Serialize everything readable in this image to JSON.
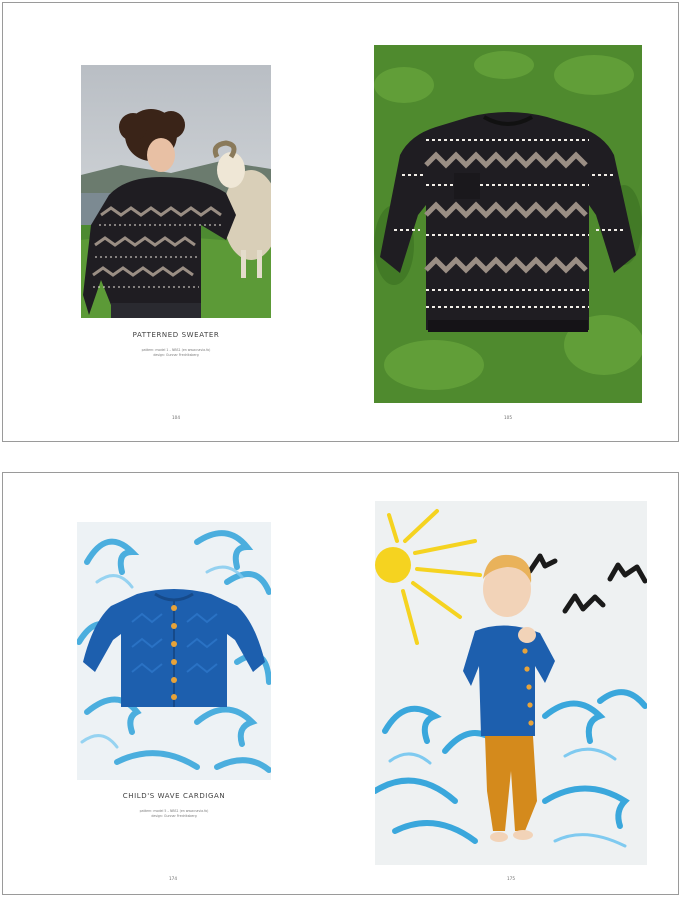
{
  "spreads": [
    {
      "left_page": {
        "photo": "man-with-sheep-photo",
        "title": "PATTERNED SWEATER",
        "pattern_line": "pattern: model 1 – NBS1 (en www.navia.fo)",
        "design_line": "design: Gunnar Fredriksberg",
        "page_number": "104"
      },
      "right_page": {
        "photo": "sweater-on-grass-photo",
        "page_number": "105"
      }
    },
    {
      "left_page": {
        "photo": "blue-cardigan-flatlay-photo",
        "title": "CHILD'S WAVE CARDIGAN",
        "pattern_line": "pattern: model 5 – NBS1 (en www.navia.fo)",
        "design_line": "design: Gunnar Fredriksberg",
        "page_number": "174"
      },
      "right_page": {
        "photo": "child-in-cardigan-photo",
        "page_number": "175"
      }
    }
  ],
  "colors": {
    "sweater_dark": "#1f1d22",
    "sweater_grey": "#8a8078",
    "grass": "#4f8a2e",
    "cardigan_blue": "#1d5fae",
    "wave_blue": "#3aa7dc",
    "sun_yellow": "#f5d320",
    "border": "#9a9a9a"
  }
}
